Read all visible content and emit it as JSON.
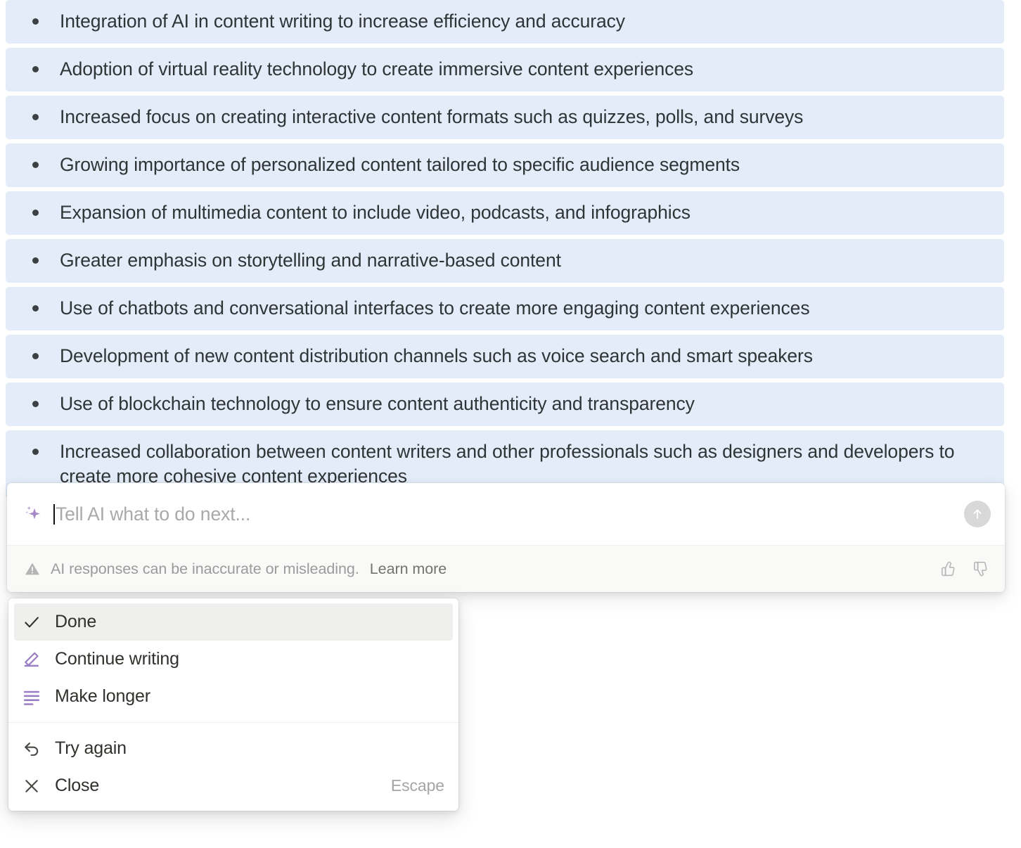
{
  "ai_result": {
    "items": [
      "Integration of AI in content writing to increase efficiency and accuracy",
      "Adoption of virtual reality technology to create immersive content experiences",
      "Increased focus on creating interactive content formats such as quizzes, polls, and surveys",
      "Growing importance of personalized content tailored to specific audience segments",
      "Expansion of multimedia content to include video, podcasts, and infographics",
      "Greater emphasis on storytelling and narrative-based content",
      "Use of chatbots and conversational interfaces to create more engaging content experiences",
      "Development of new content distribution channels such as voice search and smart speakers",
      "Use of blockchain technology to ensure content authenticity and transparency",
      "Increased collaboration between content writers and other professionals such as designers and developers to create more cohesive content experiences"
    ],
    "highlight_color": "#e3ecf8",
    "text_color": "#2f3437"
  },
  "ai_input": {
    "icon": "sparkle-icon",
    "value": "",
    "placeholder": "Tell AI what to do next...",
    "submit_icon": "arrow-up-icon",
    "accent_color": "#9b7fc4"
  },
  "disclaimer": {
    "icon": "warning-triangle-icon",
    "text": "AI responses can be inaccurate or misleading.",
    "link_label": "Learn more",
    "thumbs_up_icon": "thumbs-up-icon",
    "thumbs_down_icon": "thumbs-down-icon"
  },
  "menu": {
    "primary_items": [
      {
        "label": "Done",
        "icon": "check-icon",
        "selected": true,
        "shortcut": ""
      },
      {
        "label": "Continue writing",
        "icon": "pencil-write-icon",
        "selected": false,
        "shortcut": ""
      },
      {
        "label": "Make longer",
        "icon": "text-lines-icon",
        "selected": false,
        "shortcut": ""
      }
    ],
    "secondary_items": [
      {
        "label": "Try again",
        "icon": "undo-arrow-icon",
        "selected": false,
        "shortcut": ""
      },
      {
        "label": "Close",
        "icon": "close-x-icon",
        "selected": false,
        "shortcut": "Escape"
      }
    ]
  }
}
